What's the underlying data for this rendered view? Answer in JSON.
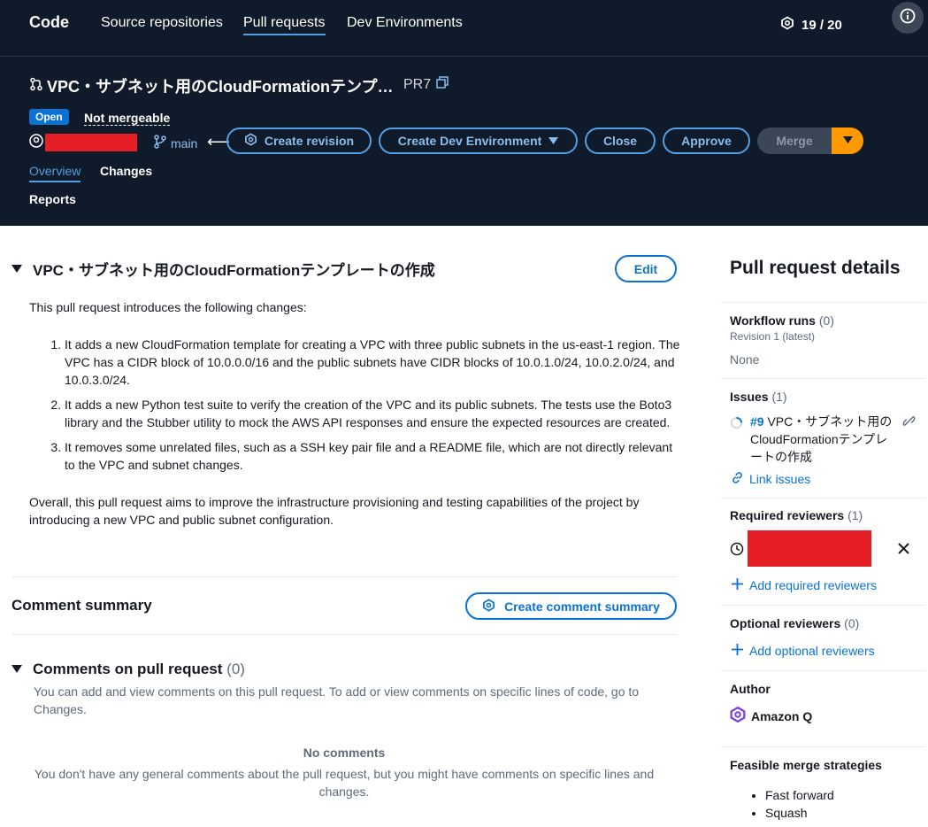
{
  "nav": {
    "brand": "Code",
    "links": [
      "Source repositories",
      "Pull requests",
      "Dev Environments"
    ],
    "counter": "19 / 20"
  },
  "pr": {
    "title": "VPC・サブネット用のCloudFormationテンプ…",
    "number": "PR7",
    "status": "Open",
    "mergeable": "Not mergeable",
    "branch": "main",
    "buttons": {
      "create_revision": "Create revision",
      "create_dev_env": "Create Dev Environment",
      "close": "Close",
      "approve": "Approve",
      "merge": "Merge"
    },
    "tabs": [
      "Overview",
      "Changes",
      "Reports"
    ]
  },
  "main": {
    "title": "VPC・サブネット用のCloudFormationテンプレートの作成",
    "edit": "Edit",
    "intro": "This pull request introduces the following changes:",
    "items": [
      "It adds a new CloudFormation template for creating a VPC with three public subnets in the us-east-1 region. The VPC has a CIDR block of 10.0.0.0/16 and the public subnets have CIDR blocks of 10.0.1.0/24, 10.0.2.0/24, and 10.0.3.0/24.",
      "It adds a new Python test suite to verify the creation of the VPC and its public subnets. The tests use the Boto3 library and the Stubber utility to mock the AWS API responses and ensure the expected resources are created.",
      "It removes some unrelated files, such as a SSH key pair file and a README file, which are not directly relevant to the VPC and subnet changes."
    ],
    "summary": "Overall, this pull request aims to improve the infrastructure provisioning and testing capabilities of the project by introducing a new VPC and public subnet configuration.",
    "comment_summary": "Comment summary",
    "create_comment_summary": "Create comment summary",
    "comments_title": "Comments on pull request",
    "comments_count": "(0)",
    "comments_desc": "You can add and view comments on this pull request. To add or view comments on specific lines of code, go to Changes.",
    "no_comments_title": "No comments",
    "no_comments_desc": "You don't have any general comments about the pull request, but you might have comments on specific lines and changes."
  },
  "side": {
    "title": "Pull request details",
    "workflow_label": "Workflow runs",
    "workflow_count": "(0)",
    "workflow_sub": "Revision 1 (latest)",
    "workflow_value": "None",
    "issues_label": "Issues",
    "issues_count": "(1)",
    "issue_num": "#9",
    "issue_title": "VPC・サブネット用のCloudFormationテンプレートの作成",
    "link_issues": "Link issues",
    "req_label": "Required reviewers",
    "req_count": "(1)",
    "add_req": "Add required reviewers",
    "opt_label": "Optional reviewers",
    "opt_count": "(0)",
    "add_opt": "Add optional reviewers",
    "author_label": "Author",
    "author_name": "Amazon Q",
    "strategies_label": "Feasible merge strategies",
    "strategies": [
      "Fast forward",
      "Squash"
    ]
  },
  "colors": {
    "header_bg": "#0f1b2a",
    "link": "#0972d3",
    "merge_accent": "#ff9900",
    "redaction": "#e61e25"
  }
}
